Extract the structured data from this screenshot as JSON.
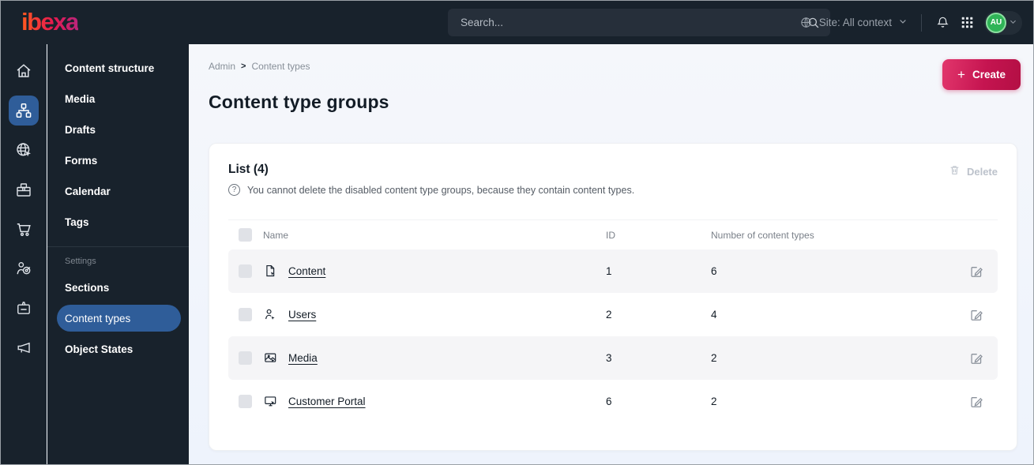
{
  "colors": {
    "topbar_bg": "#18222c",
    "active_blue": "#2f5d99",
    "accent_pink": "#c51450",
    "avatar_green": "#2fb457",
    "page_bg": "#f3f6fc"
  },
  "topbar": {
    "logo": "ibexa",
    "search_placeholder": "Search...",
    "site_selector_label": "Site: All context",
    "avatar_initials": "AU"
  },
  "sidebar": {
    "rail_icons": [
      "home-icon",
      "sitemap-icon",
      "globe-cursor-icon",
      "package-icon",
      "cart-icon",
      "target-audience-icon",
      "badge-icon",
      "megaphone-icon"
    ],
    "menu_items": [
      "Content structure",
      "Media",
      "Drafts",
      "Forms",
      "Calendar",
      "Tags"
    ],
    "settings_section": {
      "label": "Settings",
      "items": [
        "Sections",
        "Content types",
        "Object States"
      ],
      "active_item": "Content types"
    }
  },
  "main": {
    "breadcrumb": {
      "items": [
        "Admin",
        "Content types"
      ],
      "separator": ">"
    },
    "create_label": "Create",
    "page_title": "Content type groups",
    "card": {
      "list_title": "List (4)",
      "hint_icon": "help-circle-icon",
      "hint": "You cannot delete the disabled content type groups, because they contain content types.",
      "delete_label": "Delete",
      "table": {
        "columns": [
          "Name",
          "ID",
          "Number of content types"
        ],
        "rows": [
          {
            "icon": "file-icon",
            "name": "Content",
            "id": "1",
            "count": "6"
          },
          {
            "icon": "user-icon",
            "name": "Users",
            "id": "2",
            "count": "4"
          },
          {
            "icon": "image-icon",
            "name": "Media",
            "id": "3",
            "count": "2"
          },
          {
            "icon": "monitor-icon",
            "name": "Customer Portal",
            "id": "6",
            "count": "2"
          }
        ]
      }
    }
  }
}
